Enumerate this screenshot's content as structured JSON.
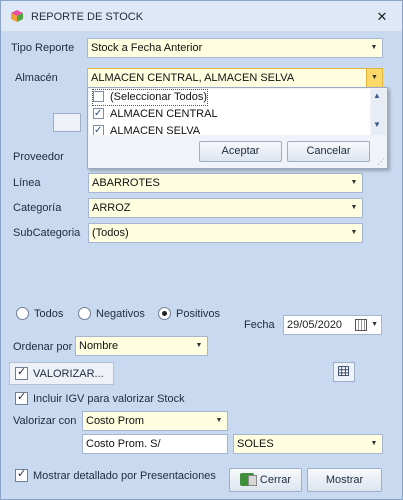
{
  "window": {
    "title": "REPORTE DE STOCK",
    "close_glyph": "✕"
  },
  "tipo_reporte": {
    "label": "Tipo Reporte",
    "value": "Stock a Fecha Anterior"
  },
  "almacen": {
    "label": "Almacén",
    "value": "ALMACEN CENTRAL, ALMACEN SELVA",
    "dropdown": {
      "items": [
        {
          "label": "(Seleccionar Todos)",
          "checked": false
        },
        {
          "label": "ALMACEN CENTRAL",
          "checked": true
        },
        {
          "label": "ALMACEN SELVA",
          "checked": true
        }
      ],
      "accept_label": "Aceptar",
      "cancel_label": "Cancelar"
    }
  },
  "proveedor": {
    "label": "Proveedor"
  },
  "linea": {
    "label": "Línea",
    "value": "ABARROTES"
  },
  "categoria": {
    "label": "Categoría",
    "value": "ARROZ"
  },
  "subcategoria": {
    "label": "SubCategoria",
    "value": "(Todos)"
  },
  "stock_filter": {
    "options": [
      "Todos",
      "Negativos",
      "Positivos"
    ],
    "selected": "Positivos"
  },
  "fecha": {
    "label": "Fecha",
    "value": "29/05/2020"
  },
  "ordenar": {
    "label": "Ordenar por",
    "value": "Nombre"
  },
  "valorizar": {
    "label": "VALORIZAR...",
    "checked": true
  },
  "incluir_igv": {
    "label": "Incluir IGV para valorizar Stock",
    "checked": true
  },
  "valorizar_con": {
    "label": "Valorizar con",
    "value": "Costo Prom"
  },
  "costo_label_field": {
    "value": "Costo Prom. S/"
  },
  "moneda": {
    "value": "SOLES"
  },
  "mostrar_detallado": {
    "label": "Mostrar detallado por Presentaciones",
    "checked": true
  },
  "buttons": {
    "cerrar": "Cerrar",
    "mostrar": "Mostrar"
  },
  "colors": {
    "window_bg": "#c9d9ef",
    "titlebar_bg": "#dfe8f6",
    "field_yellow": "#fffee0",
    "focus_orange": "#fbd86a"
  },
  "icons": {
    "app": "cube-app-icon",
    "calendar": "calendar-icon",
    "grid": "grid-icon",
    "exit": "exit-icon"
  }
}
